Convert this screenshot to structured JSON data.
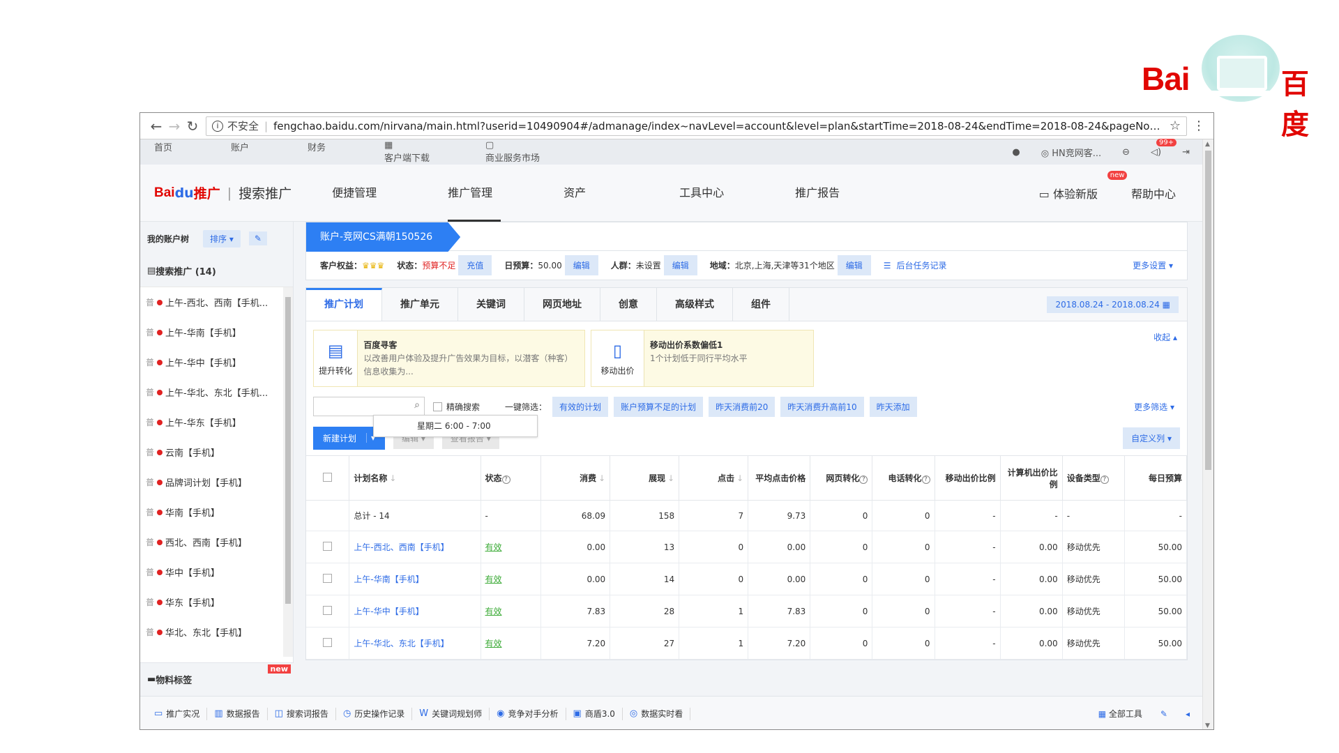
{
  "slide_logo": {
    "latin": "Bai",
    "cn": "百度"
  },
  "browser": {
    "insecure_label": "不安全",
    "url": "fengchao.baidu.com/nirvana/main.html?userid=10490904#/admanage/index~navLevel=account&level=plan&startTime=2018-08-24&endTime=2018-08-24&pageNo=1&pa..."
  },
  "util_bar": {
    "left": [
      "首页",
      "账户",
      "财务",
      "客户端下载",
      "商业服务市场"
    ],
    "user": "HN竞网客...",
    "msg_count": "99+"
  },
  "main_nav": {
    "brand_bai": "Bai",
    "brand_du": "du",
    "brand_tg": "推广",
    "brand_sub": "搜索推广",
    "items": [
      "便捷管理",
      "推广管理",
      "资产",
      "工具中心",
      "推广报告"
    ],
    "active_index": 1,
    "try_new": "体验新版",
    "new_tag": "new",
    "help": "帮助中心"
  },
  "sidebar": {
    "title": "我的账户树",
    "sort": "排序",
    "category": "搜索推广 (14)",
    "items": [
      "上午-西北、西南【手机...",
      "上午-华南【手机】",
      "上午-华中【手机】",
      "上午-华北、东北【手机...",
      "上午-华东【手机】",
      "云南【手机】",
      "品牌词计划【手机】",
      "华南【手机】",
      "西北、西南【手机】",
      "华中【手机】",
      "华东【手机】",
      "华北、东北【手机】"
    ],
    "item_prefix": "普",
    "footer": "物料标签",
    "footer_new": "new"
  },
  "account": {
    "name": "账户-竞网CS满朝150526",
    "rights_label": "客户权益：",
    "status_label": "状态：",
    "status_value": "预算不足",
    "recharge": "充值",
    "budget_label": "日预算：",
    "budget_value": "50.00",
    "edit": "编辑",
    "crowd_label": "人群：",
    "crowd_value": "未设置",
    "region_label": "地域：",
    "region_value": "北京,上海,天津等31个地区",
    "task_log": "后台任务记录",
    "more_settings": "更多设置"
  },
  "tabs": {
    "items": [
      "推广计划",
      "推广单元",
      "关键词",
      "网页地址",
      "创意",
      "高级样式",
      "组件"
    ],
    "active_index": 0,
    "date_range": "2018.08.24 - 2018.08.24"
  },
  "cards": [
    {
      "icon_label": "提升转化",
      "title": "百度寻客",
      "desc": "以改善用户体验及提升广告效果为目标，以潜客（种客）信息收集为..."
    },
    {
      "icon_label": "移动出价",
      "title": "移动出价系数偏低1",
      "desc": "1个计划低于同行平均水平"
    }
  ],
  "collapse": "收起",
  "filter": {
    "exact": "精确搜索",
    "quick_label": "一键筛选：",
    "chips": [
      "有效的计划",
      "账户预算不足的计划",
      "昨天消费前20",
      "昨天消费升高前10",
      "昨天添加"
    ],
    "more": "更多筛选",
    "tooltip": "星期二 6:00 - 7:00"
  },
  "actions": {
    "new_plan": "新建计划",
    "edit": "编辑",
    "view_report": "查看报告",
    "custom_cols": "自定义列"
  },
  "table": {
    "headers": [
      "计划名称",
      "状态",
      "消费",
      "展现",
      "点击",
      "平均点击价格",
      "网页转化",
      "电话转化",
      "移动出价比例",
      "计算机出价比例",
      "设备类型",
      "每日预算"
    ],
    "total": [
      "总计 - 14",
      "-",
      "68.09",
      "158",
      "7",
      "9.73",
      "0",
      "0",
      "-",
      "-",
      "-",
      "-"
    ],
    "rows": [
      [
        "上午-西北、西南【手机】",
        "有效",
        "0.00",
        "13",
        "0",
        "0.00",
        "0",
        "0",
        "-",
        "0.00",
        "移动优先",
        "50.00"
      ],
      [
        "上午-华南【手机】",
        "有效",
        "0.00",
        "14",
        "0",
        "0.00",
        "0",
        "0",
        "-",
        "0.00",
        "移动优先",
        "50.00"
      ],
      [
        "上午-华中【手机】",
        "有效",
        "7.83",
        "28",
        "1",
        "7.83",
        "0",
        "0",
        "-",
        "0.00",
        "移动优先",
        "50.00"
      ],
      [
        "上午-华北、东北【手机】",
        "有效",
        "7.20",
        "27",
        "1",
        "7.20",
        "0",
        "0",
        "-",
        "0.00",
        "移动优先",
        "50.00"
      ]
    ]
  },
  "bottom_bar": {
    "items": [
      "推广实况",
      "数据报告",
      "搜索词报告",
      "历史操作记录",
      "关键词规划师",
      "竞争对手分析",
      "商盾3.0",
      "数据实时看"
    ],
    "all_tools": "全部工具"
  },
  "colors": {
    "accent": "#2d7ff3",
    "warn": "#e02222",
    "ok": "#3aaa35",
    "brand_red": "#e10602"
  }
}
